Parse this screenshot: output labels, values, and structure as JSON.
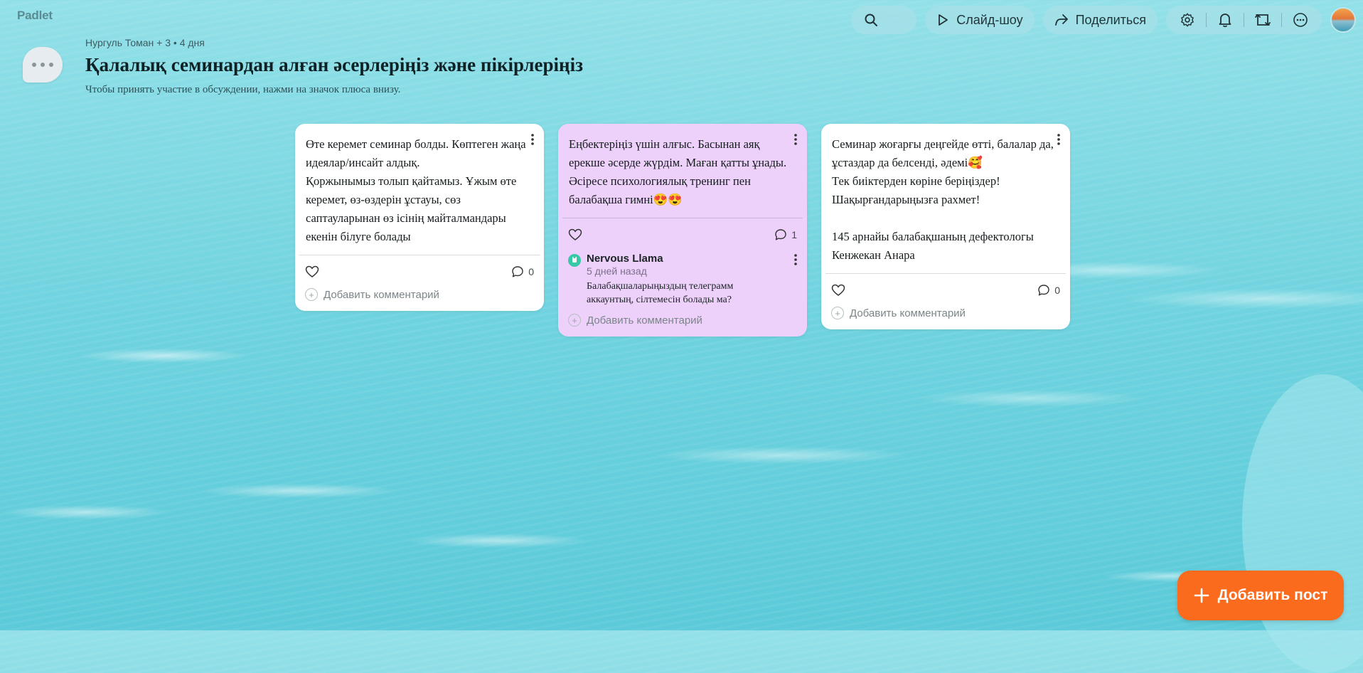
{
  "brand": "Padlet",
  "header": {
    "meta": "Нургуль Томан + 3 • 4 дня",
    "title": "Қалалық семинардан алған әсерлеріңіз және пікірлеріңіз",
    "subtitle": "Чтобы принять участие в обсуждении, нажми на значок плюса внизу."
  },
  "toolbar": {
    "slideshow_label": "Слайд-шоу",
    "share_label": "Поделиться",
    "icons": [
      "search-icon",
      "play-icon",
      "share-icon",
      "gear-icon",
      "bell-icon",
      "remake-icon",
      "more-icon"
    ]
  },
  "cards": [
    {
      "text": "Өте керемет семинар болды. Көптеген жаңа идеялар/инсайт алдық.\nҚоржынымыз толып қайтамыз. Ұжым өте керемет, өз-өздерін ұстауы, сөз саптауларынан өз ісінің майталмандары екенін білуге болады",
      "comment_count": "0",
      "add_comment": "Добавить комментарий",
      "color": "#ffffff"
    },
    {
      "text": "Еңбектеріңіз үшін алғыс. Басынан аяқ ерекше әсерде жүрдім. Маған қатты ұнады. Әсіресе психологиялық тренинг пен балабақша гимні😍😍",
      "comment_count": "1",
      "add_comment": "Добавить комментарий",
      "color": "#edd1fb",
      "comment": {
        "author": "Nervous Llama",
        "time": "5 дней назад",
        "text": "Балабақшаларыңыздың телеграмм аккаунтың, сілтемесін болады ма?"
      }
    },
    {
      "text": "Семинар жоғарғы деңгейде өтті, балалар да, ұстаздар да белсенді, әдемі🥰\nТек биіктерден көріне беріңіздер!\nШақырғандарыңызға рахмет!\n\n145 арнайы балабақшаның дефектологы Кенжекан Анара",
      "comment_count": "0",
      "add_comment": "Добавить комментарий",
      "color": "#ffffff"
    }
  ],
  "add_post_label": "Добавить пост",
  "colors": {
    "accent": "#fb6b1e",
    "purple_card": "#edd1fb"
  }
}
